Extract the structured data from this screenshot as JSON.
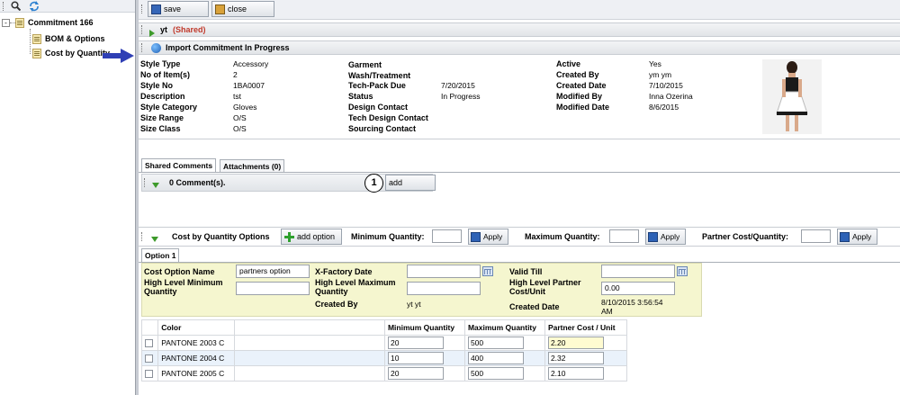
{
  "tree": {
    "root": "Commitment 166",
    "children": [
      "BOM & Options",
      "Cost by Quantity"
    ]
  },
  "toolbar": {
    "save_label": "save",
    "close_label": "close"
  },
  "header_bar": {
    "name": "yt",
    "shared": "(Shared)"
  },
  "status_bar": {
    "label": "Import Commitment In Progress"
  },
  "details": {
    "col1": [
      {
        "label": "Style Type",
        "value": "Accessory"
      },
      {
        "label": "No of Item(s)",
        "value": "2"
      },
      {
        "label": "Style No",
        "value": "1BA0007"
      },
      {
        "label": "Description",
        "value": "tst"
      },
      {
        "label": "Style Category",
        "value": "Gloves"
      },
      {
        "label": "Size Range",
        "value": "O/S"
      },
      {
        "label": "Size Class",
        "value": "O/S"
      }
    ],
    "col2": [
      {
        "label": "Garment Wash/Treatment",
        "value": ""
      },
      {
        "label": "Tech-Pack Due",
        "value": "7/20/2015"
      },
      {
        "label": "Status",
        "value": "In Progress"
      },
      {
        "label": "Design Contact",
        "value": ""
      },
      {
        "label": "Tech Design Contact",
        "value": ""
      },
      {
        "label": "Sourcing Contact",
        "value": ""
      }
    ],
    "col3": [
      {
        "label": "Active",
        "value": "Yes"
      },
      {
        "label": "Created By",
        "value": "ym ym"
      },
      {
        "label": "Created Date",
        "value": "7/10/2015"
      },
      {
        "label": "Modified By",
        "value": "Inna Ozerina"
      },
      {
        "label": "Modified Date",
        "value": "8/6/2015"
      }
    ]
  },
  "tabs": [
    "Shared Comments",
    "Attachments (0)"
  ],
  "comments": {
    "count_label": "0 Comment(s).",
    "add_label": "add",
    "marker": "1"
  },
  "cost_options": {
    "title": "Cost by Quantity Options",
    "add_option_label": "add option",
    "min_qty_label": "Minimum Quantity:",
    "max_qty_label": "Maximum Quantity:",
    "partner_cost_label": "Partner Cost/Quantity:",
    "apply_label": "Apply"
  },
  "option_tab": "Option 1",
  "option_form": {
    "cost_option_name_label": "Cost Option Name",
    "cost_option_name_value": "partners option",
    "hl_min_qty_label": "High Level Minimum Quantity",
    "x_factory_label": "X-Factory Date",
    "hl_max_qty_label": "High Level Maximum Quantity",
    "created_by_label": "Created By",
    "created_by_value": "yt yt",
    "valid_till_label": "Valid Till",
    "hl_partner_cost_label": "High Level Partner Cost/Unit",
    "hl_partner_cost_value": "0.00",
    "created_date_label": "Created Date",
    "created_date_value": "8/10/2015 3:56:54 AM"
  },
  "grid": {
    "headers": [
      "Color",
      "",
      "Minimum Quantity",
      "Maximum Quantity",
      "Partner Cost / Unit"
    ],
    "rows": [
      {
        "color": "PANTONE 2003 C",
        "min": "20",
        "max": "500",
        "cost": "2.20"
      },
      {
        "color": "PANTONE 2004 C",
        "min": "10",
        "max": "400",
        "cost": "2.32"
      },
      {
        "color": "PANTONE 2005 C",
        "min": "20",
        "max": "500",
        "cost": "2.10"
      }
    ]
  },
  "colors": {
    "shared": "#c0392b",
    "arrow": "#2f3fb5",
    "option_panel": "#f5f6cf"
  }
}
